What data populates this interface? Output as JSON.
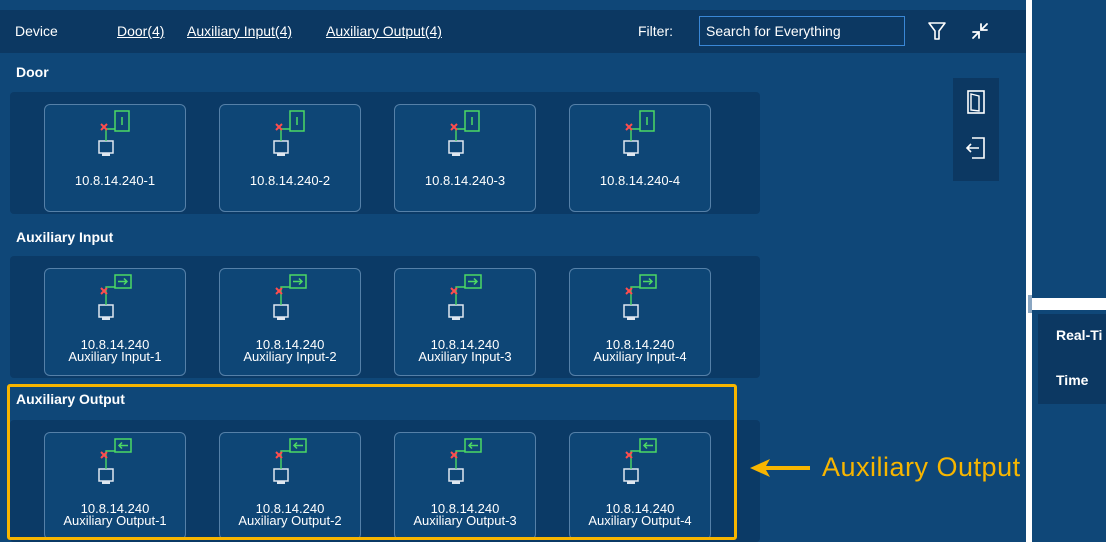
{
  "toolbar": {
    "device_label": "Device",
    "filter_links": [
      "Door(4)",
      "Auxiliary Input(4)",
      "Auxiliary Output(4)"
    ],
    "filter_label": "Filter:",
    "search_placeholder": "Search for Everything",
    "icons": [
      "filter-funnel-icon",
      "collapse-arrows-icon"
    ]
  },
  "sections": [
    {
      "title": "Door",
      "icon": "door-icon",
      "cards": [
        {
          "line1": "10.8.14.240-1",
          "line2": ""
        },
        {
          "line1": "10.8.14.240-2",
          "line2": ""
        },
        {
          "line1": "10.8.14.240-3",
          "line2": ""
        },
        {
          "line1": "10.8.14.240-4",
          "line2": ""
        }
      ]
    },
    {
      "title": "Auxiliary Input",
      "icon": "auxiliary-input-icon",
      "cards": [
        {
          "line1": "10.8.14.240",
          "line2": "Auxiliary Input-1"
        },
        {
          "line1": "10.8.14.240",
          "line2": "Auxiliary Input-2"
        },
        {
          "line1": "10.8.14.240",
          "line2": "Auxiliary Input-3"
        },
        {
          "line1": "10.8.14.240",
          "line2": "Auxiliary Input-4"
        }
      ]
    },
    {
      "title": "Auxiliary Output",
      "icon": "auxiliary-output-icon",
      "cards": [
        {
          "line1": "10.8.14.240",
          "line2": "Auxiliary Output-1"
        },
        {
          "line1": "10.8.14.240",
          "line2": "Auxiliary Output-2"
        },
        {
          "line1": "10.8.14.240",
          "line2": "Auxiliary Output-3"
        },
        {
          "line1": "10.8.14.240",
          "line2": "Auxiliary Output-4"
        }
      ]
    }
  ],
  "side_panel": {
    "icons": [
      "door-open-icon",
      "exit-arrow-icon"
    ]
  },
  "right_panel": {
    "header_label": "Real-Ti",
    "time_label": "Time"
  },
  "annotation": {
    "text": "Auxiliary  Output"
  },
  "colors": {
    "background": "#0f4778",
    "toolbar": "#0c3862",
    "accent_green": "#4cd964",
    "offline_red": "#ff4d4d",
    "highlight": "#f7b500"
  }
}
